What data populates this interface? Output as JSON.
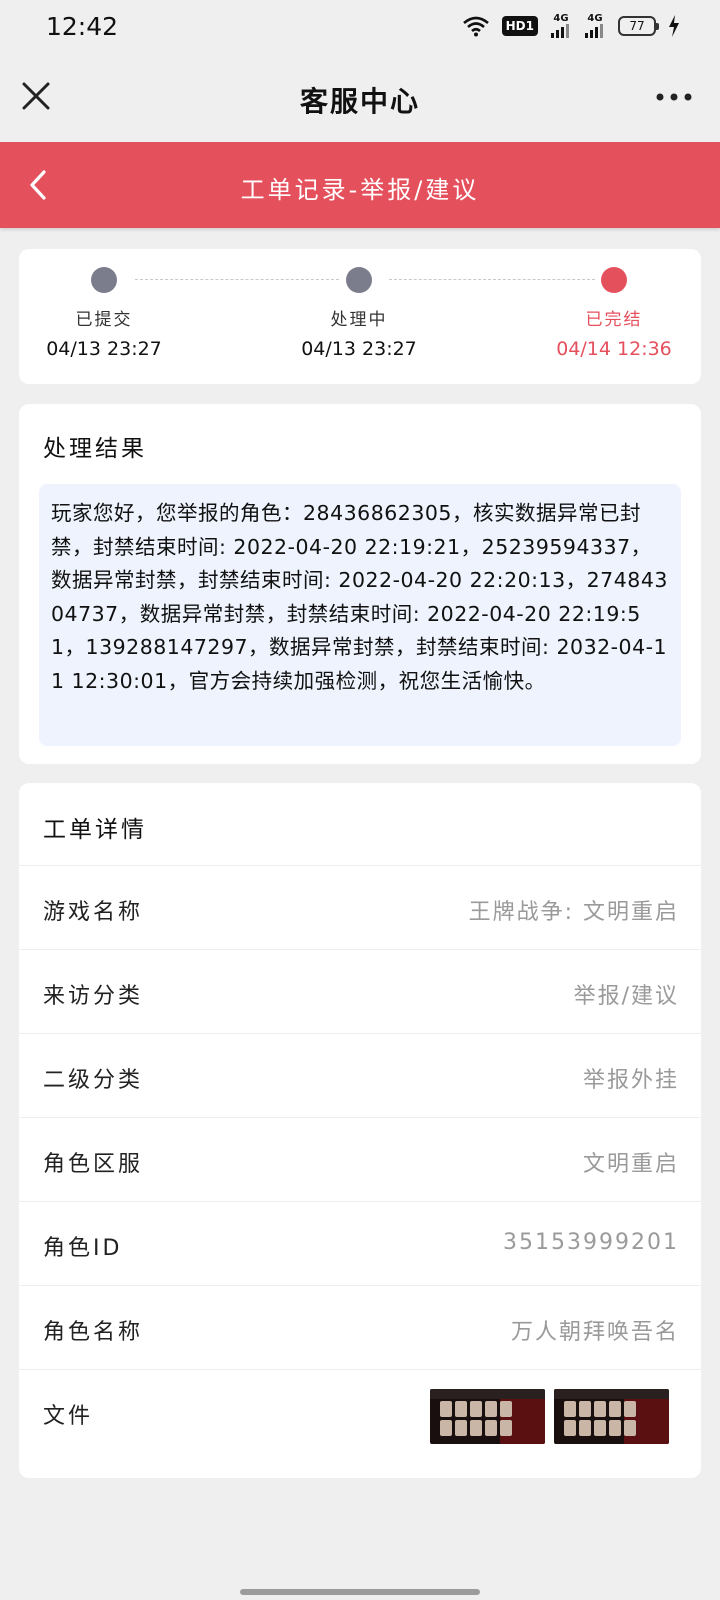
{
  "status_bar": {
    "time": "12:42",
    "hd_label": "HD1",
    "signal_1_label": "4G",
    "signal_2_label": "4G",
    "battery": "77"
  },
  "title_bar": {
    "title": "客服中心",
    "close_icon": "close-icon",
    "more_icon": "more-icon"
  },
  "header": {
    "title": "工单记录-举报/建议",
    "back_icon": "chevron-left-icon",
    "color": "#e5505d"
  },
  "progress": {
    "steps": [
      {
        "label": "已提交",
        "time": "04/13 23:27"
      },
      {
        "label": "处理中",
        "time": "04/13 23:27"
      },
      {
        "label": "已完结",
        "time": "04/14 12:36"
      }
    ],
    "active_color": "#e5505d",
    "inactive_color": "#7b7d8c"
  },
  "result": {
    "title": "处理结果",
    "text": "玩家您好，您举报的角色：28436862305，核实数据异常已封禁，封禁结束时间: 2022-04-20 22:19:21，25239594337，数据异常封禁，封禁结束时间: 2022-04-20 22:20:13，27484304737，数据异常封禁，封禁结束时间: 2022-04-20 22:19:51，139288147297，数据异常封禁，封禁结束时间: 2032-04-11 12:30:01，官方会持续加强检测，祝您生活愉快。"
  },
  "detail": {
    "title": "工单详情",
    "rows": [
      {
        "label": "游戏名称",
        "value": "王牌战争: 文明重启"
      },
      {
        "label": "来访分类",
        "value": "举报/建议"
      },
      {
        "label": "二级分类",
        "value": "举报外挂"
      },
      {
        "label": "角色区服",
        "value": "文明重启"
      },
      {
        "label": "角色ID",
        "value": "35153999201"
      },
      {
        "label": "角色名称",
        "value": "万人朝拜唤吾名"
      }
    ],
    "file_label": "文件"
  }
}
